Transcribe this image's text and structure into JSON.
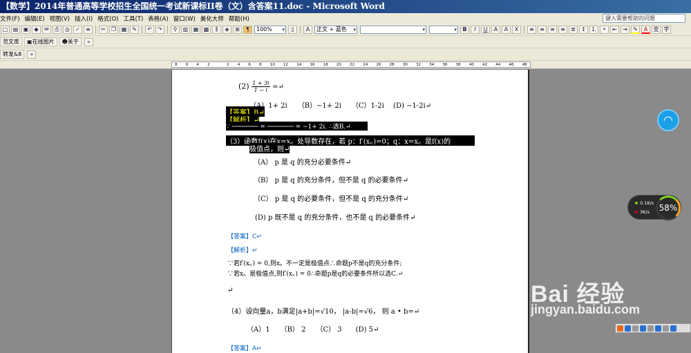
{
  "window": {
    "title": "【数学】2014年普通高等学校招生全国统一考试新课标II卷（文）含答案11.doc - Microsoft Word"
  },
  "menu": {
    "items": [
      "文件(F)",
      "编辑(E)",
      "视图(V)",
      "插入(I)",
      "格式(O)",
      "工具(T)",
      "表格(A)",
      "窗口(W)",
      "美化大师",
      "帮助(H)"
    ],
    "help_placeholder": "键入需要帮助的问题"
  },
  "toolbar": {
    "zoom": "100%",
    "style": "正文 + 蓝色",
    "font": "",
    "size": ""
  },
  "toolbar2": {
    "btn1": "范文库",
    "btn2": "在线图片",
    "btn3": "关于"
  },
  "toolbar3": {
    "btn1": "转发&8"
  },
  "ruler": {
    "ticks": [
      "8",
      "6",
      "4",
      "2",
      "",
      "2",
      "4",
      "6",
      "8",
      "10",
      "12",
      "14",
      "16",
      "18",
      "20",
      "22",
      "24",
      "26",
      "28",
      "30",
      "32",
      "34",
      "36",
      "38",
      "40",
      "42",
      "44",
      "46",
      "48"
    ]
  },
  "doc": {
    "q2_label": "(2)",
    "q2_num": "1 + 3i",
    "q2_den": "1 − i",
    "q2_eq": "=↵",
    "q2_opts": "（A）1+ 2i　　（B）−1+ 2i　　（C）1-2i　 (D) −1-2i↵",
    "ans_tag1": "【答案】B↵",
    "ana_tag1": "【解析】↵",
    "ana_line1": "∵ ─────── = ─────── = −1+ 2i. ∴选B.↵",
    "q3_line1": "（3）函数f(x)在x=x。处导数存在，若 p：f′(x。)=0；q：x=x。是f(x)的",
    "q3_line2": "极值点，则↵",
    "q3_a": "（A） p 是 q 的充分必要条件↵",
    "q3_b": "（B） p 是 q 的充分条件，但不是 q 的必要条件↵",
    "q3_c": "（C） p 是 q 的必要条件，但不是  q 的充分条件↵",
    "q3_d": "(D)  p 既不是 q 的充分条件，也不是 q 的必要条件↵",
    "ans_tag2": "【答案】C↵",
    "ana_tag2": "【解析】↵",
    "ana2_l1": "∵若f′(x。) = 0,则x。不一定是极值点∴命题p不是q的充分条件;",
    "ana2_l2": "∵若x。是极值点,则f′(x。) = 0∴命题p是q的必要条件所以选C.↵",
    "blank": "↵",
    "q4_line": "（4）设向量a，b满足|a+b|=√10， |a-b|=√6， 则 a • b=↵",
    "q4_opts": "（A）1　　（B） 2　　（C） 3　　(D) 5↵",
    "ans_tag3": "【答案】A↵"
  },
  "overlays": {
    "speed_up": "0.1K/s",
    "speed_down": "3K/s",
    "cpu_percent": "58%",
    "watermark": "Bai  经验",
    "watermark_sub": "jingyan.baidu.com"
  }
}
